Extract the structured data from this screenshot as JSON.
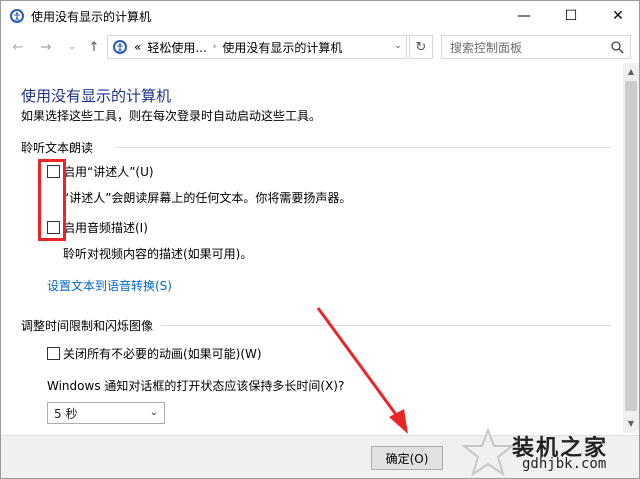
{
  "window": {
    "title": "使用没有显示的计算机",
    "minimize": "—",
    "maximize": "☐",
    "close": "✕"
  },
  "nav": {
    "back": "←",
    "forward": "→",
    "recent": "⌄",
    "up": "↑",
    "breadcrumb_prefix": "«",
    "breadcrumb_parent": "轻松使用...",
    "breadcrumb_current": "使用没有显示的计算机",
    "separator": "›",
    "dropdown": "⌄",
    "refresh": "↻",
    "search_placeholder": "搜索控制面板"
  },
  "content": {
    "title": "使用没有显示的计算机",
    "subtitle": "如果选择这些工具，则在每次登录时自动启动这些工具。",
    "section_tts": {
      "header": "聆听文本朗读",
      "narrator_label": "启用“讲述人”(U)",
      "narrator_desc": "“讲述人”会朗读屏幕上的任何文本。你将需要扬声器。",
      "audio_desc_label": "启用音频描述(I)",
      "audio_desc_desc": "聆听对视频内容的描述(如果可用)。",
      "tts_link": "设置文本到语音转换(S)"
    },
    "section_timing": {
      "header": "调整时间限制和闪烁图像",
      "animations_label": "关闭所有不必要的动画(如果可能)(W)",
      "notification_question": "Windows 通知对话框的打开状态应该保持多长时间(X)?",
      "duration_selected": "5 秒"
    }
  },
  "footer": {
    "ok_label": "确定(O)"
  },
  "watermark": {
    "title": "装机之家",
    "url": "gdhjbk.com"
  },
  "colors": {
    "title_blue": "#1e3287",
    "link_blue": "#0066cc",
    "highlight_red": "#e8262a"
  }
}
